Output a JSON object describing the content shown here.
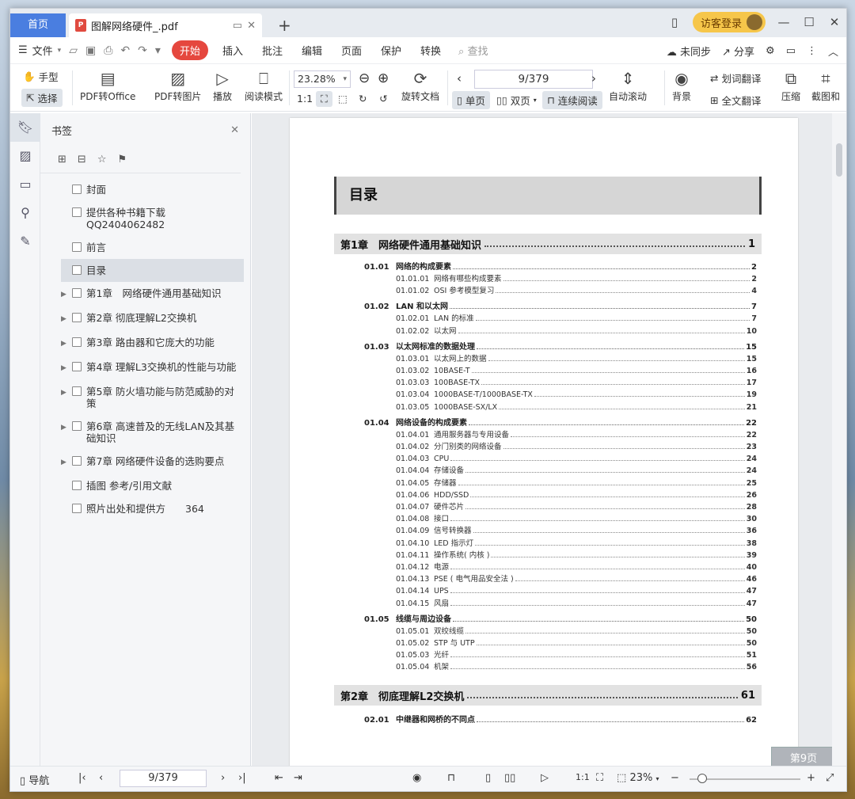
{
  "tabs": {
    "home": "首页",
    "doc_title": "图解网络硬件_.pdf"
  },
  "account": {
    "visitor_label": "访客登录"
  },
  "menu": {
    "file": "文件",
    "start": "开始",
    "items": [
      "插入",
      "批注",
      "编辑",
      "页面",
      "保护",
      "转换"
    ],
    "search_placeholder": "查找",
    "sync": "未同步",
    "share": "分享"
  },
  "ribbon": {
    "hand": "手型",
    "select": "选择",
    "pdf_to_office": "PDF转Office",
    "pdf_to_image": "PDF转图片",
    "play": "播放",
    "read_mode": "阅读模式",
    "zoom": "23.28%",
    "page": "9/379",
    "rotate": "旋转文档",
    "single": "单页",
    "double": "双页",
    "continuous": "连续阅读",
    "auto_scroll": "自动滚动",
    "background": "背景",
    "word_translate": "划词翻译",
    "full_translate": "全文翻译",
    "compress": "压缩",
    "screenshot": "截图和"
  },
  "sidebar": {
    "title": "书签",
    "items": [
      {
        "label": "封面",
        "expandable": false
      },
      {
        "label": "提供各种书籍下载QQ2404062482",
        "expandable": false
      },
      {
        "label": "前言",
        "expandable": false
      },
      {
        "label": "目录",
        "expandable": false,
        "active": true
      },
      {
        "label": "第1章　网络硬件通用基础知识",
        "expandable": true
      },
      {
        "label": "第2章 彻底理解L2交换机",
        "expandable": true
      },
      {
        "label": "第3章 路由器和它庞大的功能",
        "expandable": true
      },
      {
        "label": "第4章 理解L3交换机的性能与功能",
        "expandable": true
      },
      {
        "label": "第5章 防火墙功能与防范威胁的对策",
        "expandable": true
      },
      {
        "label": "第6章 高速普及的无线LAN及其基础知识",
        "expandable": true
      },
      {
        "label": "第7章 网络硬件设备的选购要点",
        "expandable": true
      },
      {
        "label": "插图 参考/引用文献",
        "expandable": false
      },
      {
        "label": "照片出处和提供方　　364",
        "expandable": false
      }
    ]
  },
  "document": {
    "toc_title": "目录",
    "chapter1": {
      "label": "第1章　网络硬件通用基础知识",
      "page": "1"
    },
    "chapter2": {
      "label": "第2章　彻底理解L2交换机",
      "page": "61"
    },
    "entries": [
      {
        "level": "sec",
        "num": "01.01",
        "name": "网络的构成要素",
        "page": "2"
      },
      {
        "level": "sub",
        "num": "01.01.01",
        "name": "网络有哪些构成要素",
        "page": "2"
      },
      {
        "level": "sub",
        "num": "01.01.02",
        "name": "OSI 参考模型复习",
        "page": "4"
      },
      {
        "level": "sec",
        "num": "01.02",
        "name": "LAN 和以太网",
        "page": "7"
      },
      {
        "level": "sub",
        "num": "01.02.01",
        "name": "LAN 的标准",
        "page": "7"
      },
      {
        "level": "sub",
        "num": "01.02.02",
        "name": "以太网",
        "page": "10"
      },
      {
        "level": "sec",
        "num": "01.03",
        "name": "以太网标准的数据处理",
        "page": "15"
      },
      {
        "level": "sub",
        "num": "01.03.01",
        "name": "以太网上的数据",
        "page": "15"
      },
      {
        "level": "sub",
        "num": "01.03.02",
        "name": "10BASE-T",
        "page": "16"
      },
      {
        "level": "sub",
        "num": "01.03.03",
        "name": "100BASE-TX",
        "page": "17"
      },
      {
        "level": "sub",
        "num": "01.03.04",
        "name": "1000BASE-T/1000BASE-TX",
        "page": "19"
      },
      {
        "level": "sub",
        "num": "01.03.05",
        "name": "1000BASE-SX/LX",
        "page": "21"
      },
      {
        "level": "sec",
        "num": "01.04",
        "name": "网络设备的构成要素",
        "page": "22"
      },
      {
        "level": "sub",
        "num": "01.04.01",
        "name": "通用服务器与专用设备",
        "page": "22"
      },
      {
        "level": "sub",
        "num": "01.04.02",
        "name": "分门别类的网络设备",
        "page": "23"
      },
      {
        "level": "sub",
        "num": "01.04.03",
        "name": "CPU",
        "page": "24"
      },
      {
        "level": "sub",
        "num": "01.04.04",
        "name": "存储设备",
        "page": "24"
      },
      {
        "level": "sub",
        "num": "01.04.05",
        "name": "存储器",
        "page": "25"
      },
      {
        "level": "sub",
        "num": "01.04.06",
        "name": "HDD/SSD",
        "page": "26"
      },
      {
        "level": "sub",
        "num": "01.04.07",
        "name": "硬件芯片",
        "page": "28"
      },
      {
        "level": "sub",
        "num": "01.04.08",
        "name": "接口",
        "page": "30"
      },
      {
        "level": "sub",
        "num": "01.04.09",
        "name": "信号转换器",
        "page": "36"
      },
      {
        "level": "sub",
        "num": "01.04.10",
        "name": "LED 指示灯",
        "page": "38"
      },
      {
        "level": "sub",
        "num": "01.04.11",
        "name": "操作系统( 内核 )",
        "page": "39"
      },
      {
        "level": "sub",
        "num": "01.04.12",
        "name": "电源",
        "page": "40"
      },
      {
        "level": "sub",
        "num": "01.04.13",
        "name": "PSE ( 电气用品安全法 )",
        "page": "46"
      },
      {
        "level": "sub",
        "num": "01.04.14",
        "name": "UPS",
        "page": "47"
      },
      {
        "level": "sub",
        "num": "01.04.15",
        "name": "风扇",
        "page": "47"
      },
      {
        "level": "sec",
        "num": "01.05",
        "name": "线缆与周边设备",
        "page": "50"
      },
      {
        "level": "sub",
        "num": "01.05.01",
        "name": "双绞线缆",
        "page": "50"
      },
      {
        "level": "sub",
        "num": "01.05.02",
        "name": "STP 与 UTP",
        "page": "50"
      },
      {
        "level": "sub",
        "num": "01.05.03",
        "name": "光纤",
        "page": "51"
      },
      {
        "level": "sub",
        "num": "01.05.04",
        "name": "机架",
        "page": "56"
      }
    ],
    "chapter2_entry": {
      "num": "02.01",
      "name": "中继器和网桥的不同点",
      "page": "62"
    },
    "page_badge": "第9页"
  },
  "statusbar": {
    "nav": "导航",
    "page": "9/379",
    "zoom": "23%"
  }
}
